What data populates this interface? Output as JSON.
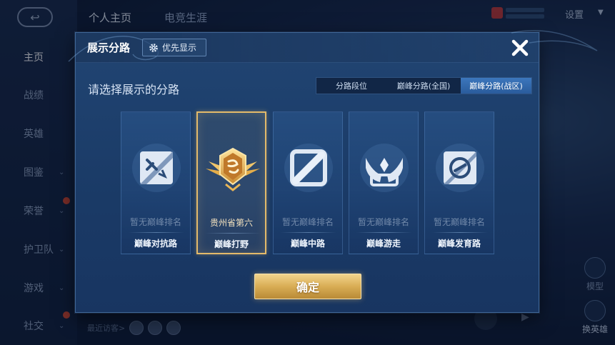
{
  "sidebar": {
    "items": [
      {
        "label": "主页",
        "active": true
      },
      {
        "label": "战绩"
      },
      {
        "label": "英雄"
      },
      {
        "label": "图鉴"
      },
      {
        "label": "荣誉"
      },
      {
        "label": "护卫队"
      },
      {
        "label": "游戏"
      },
      {
        "label": "社交"
      }
    ]
  },
  "header": {
    "tabs": [
      {
        "label": "个人主页",
        "active": true
      },
      {
        "label": "电竞生涯"
      }
    ],
    "settings_label": "设置"
  },
  "footer": {
    "visitors_label": "最近访客>",
    "mode_label": "模型",
    "swap_hero_label": "换英雄"
  },
  "modal": {
    "title": "展示分路",
    "priority_button_label": "优先显示",
    "subtitle": "请选择展示的分路",
    "tabs": [
      {
        "label": "分路段位"
      },
      {
        "label": "巅峰分路(全国)"
      },
      {
        "label": "巅峰分路(战区)",
        "active": true
      }
    ],
    "lanes": [
      {
        "rank": "暂无巅峰排名",
        "name": "巅峰对抗路",
        "icon": "sword-shield-icon"
      },
      {
        "rank": "贵州省第六",
        "name": "巅峰打野",
        "icon": "gold-wing-emblem-icon",
        "selected": true
      },
      {
        "rank": "暂无巅峰排名",
        "name": "巅峰中路",
        "icon": "diagonal-lane-icon"
      },
      {
        "rank": "暂无巅峰排名",
        "name": "巅峰游走",
        "icon": "wings-icon"
      },
      {
        "rank": "暂无巅峰排名",
        "name": "巅峰发育路",
        "icon": "target-icon"
      }
    ],
    "confirm_label": "确定"
  },
  "colors": {
    "modal_bg": "#1d3d6a",
    "selected_border": "#e3ba6a",
    "confirm_gold": "#d9ad55",
    "active_tab": "#3c77bd"
  }
}
